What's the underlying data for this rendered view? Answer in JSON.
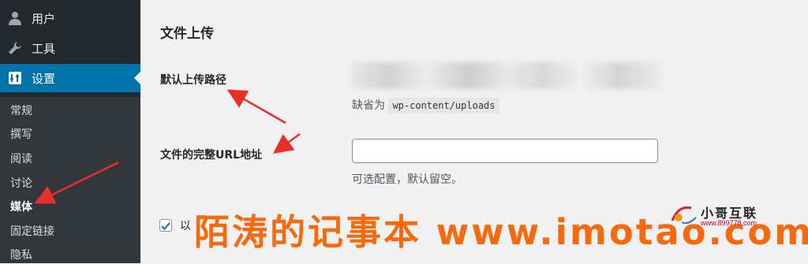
{
  "sidebar": {
    "top_items": [
      {
        "label": "用户",
        "icon": "user-icon"
      },
      {
        "label": "工具",
        "icon": "wrench-icon"
      },
      {
        "label": "设置",
        "icon": "settings-icon",
        "current": true
      }
    ],
    "submenu": [
      "常规",
      "撰写",
      "阅读",
      "讨论",
      "媒体",
      "固定链接",
      "隐私"
    ],
    "active_submenu": "媒体"
  },
  "main": {
    "section_title": "文件上传",
    "upload_path": {
      "label": "默认上传路径",
      "description_prefix": "缺省为",
      "description_code": "wp-content/uploads"
    },
    "full_url": {
      "label": "文件的完整URL地址",
      "value": "",
      "description": "可选配置，默认留空。"
    },
    "checkbox": {
      "checked": true,
      "label": "以"
    }
  },
  "watermark": {
    "text": "陌涛的记事本 www.imotao.com",
    "logo_title": "小哥互联",
    "logo_sub": "www.899778.com"
  },
  "colors": {
    "sidebar_bg": "#23282d",
    "submenu_bg": "#32373c",
    "current_menu": "#0073aa",
    "annotation_arrow": "#e8302a",
    "watermark": "#f56a0f"
  }
}
